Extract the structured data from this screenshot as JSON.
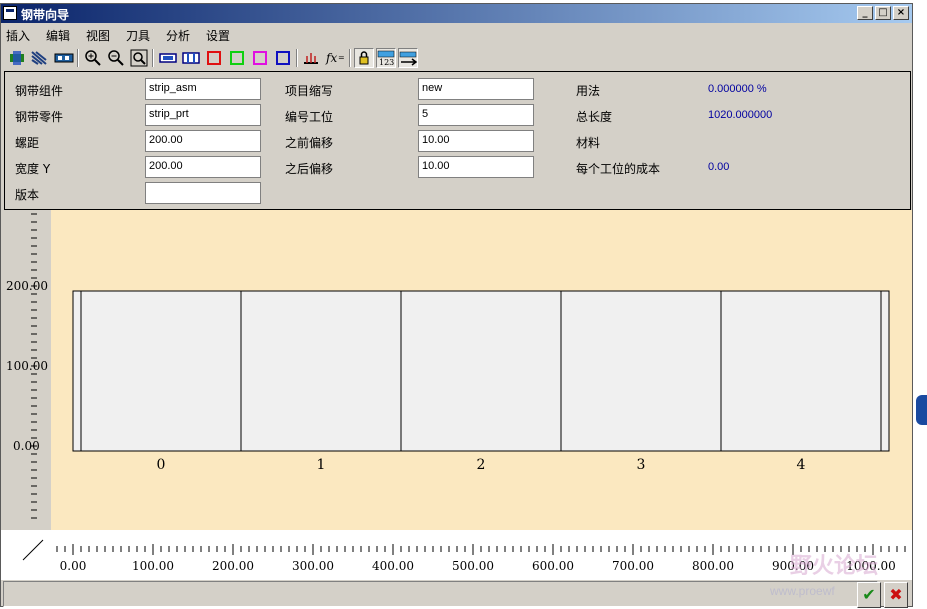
{
  "window": {
    "title": "钢带向导"
  },
  "menu": [
    "插入",
    "编辑",
    "视图",
    "刀具",
    "分析",
    "设置"
  ],
  "params": {
    "strip_asm_label": "钢带组件",
    "strip_asm_value": "strip_asm",
    "strip_prt_label": "钢带零件",
    "strip_prt_value": "strip_prt",
    "pitch_label": "螺距",
    "pitch_value": "200.00",
    "width_label": "宽度 Y",
    "width_value": "200.00",
    "version_label": "版本",
    "version_value": "",
    "prefix_label": "项目缩写",
    "prefix_value": "new",
    "stations_label": "编号工位",
    "stations_value": "5",
    "offset_before_label": "之前偏移",
    "offset_before_value": "10.00",
    "offset_after_label": "之后偏移",
    "offset_after_value": "10.00",
    "usage_label": "用法",
    "usage_value": "0.000000 %",
    "total_length_label": "总长度",
    "total_length_value": "1020.000000",
    "material_label": "材料",
    "cost_label": "每个工位的成本",
    "cost_value": "0.00"
  },
  "drawing": {
    "y_ticks": [
      "200.00",
      "100.00",
      "0.00"
    ],
    "station_labels": [
      "0",
      "1",
      "2",
      "3",
      "4"
    ],
    "x_ticks": [
      "0.00",
      "100.00",
      "200.00",
      "300.00",
      "400.00",
      "500.00",
      "600.00",
      "700.00",
      "800.00",
      "900.00",
      "1000.00"
    ],
    "strip_fill": "#f0f0f0",
    "bg_color": "#fbe8c0"
  },
  "watermark": {
    "text": "野火论坛",
    "url": "www.proewf"
  }
}
